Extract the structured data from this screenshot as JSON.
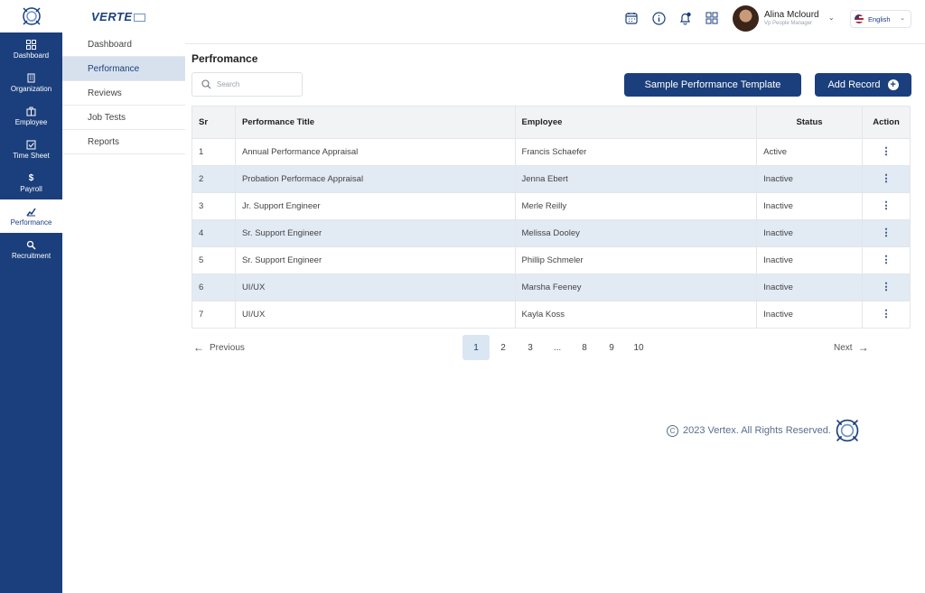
{
  "brand": {
    "name": "VERTE"
  },
  "rail": {
    "items": [
      {
        "label": "Dashboard",
        "icon": "grid-icon"
      },
      {
        "label": "Organization",
        "icon": "building-icon"
      },
      {
        "label": "Employee",
        "icon": "briefcase-icon"
      },
      {
        "label": "Time Sheet",
        "icon": "check-square-icon"
      },
      {
        "label": "Payroll",
        "icon": "dollar-icon"
      },
      {
        "label": "Performance",
        "icon": "chart-icon"
      },
      {
        "label": "Recruitment",
        "icon": "search-person-icon"
      }
    ],
    "active": "Performance"
  },
  "subnav": {
    "items": [
      {
        "label": "Dashboard"
      },
      {
        "label": "Performance"
      },
      {
        "label": "Reviews"
      },
      {
        "label": "Job Tests"
      },
      {
        "label": "Reports"
      }
    ],
    "active": "Performance"
  },
  "user": {
    "name": "Alina Mclourd",
    "role": "Vp People Manager"
  },
  "language": {
    "label": "English"
  },
  "page": {
    "title": "Perfromance"
  },
  "search": {
    "placeholder": "Search"
  },
  "buttons": {
    "template": "Sample Performance Template",
    "add": "Add Record"
  },
  "table": {
    "headers": {
      "sr": "Sr",
      "title": "Performance Title",
      "employee": "Employee",
      "status": "Status",
      "action": "Action"
    },
    "rows": [
      {
        "sr": "1",
        "title": "Annual Performance Appraisal",
        "employee": "Francis Schaefer",
        "status": "Active"
      },
      {
        "sr": "2",
        "title": "Probation Performace Appraisal",
        "employee": "Jenna Ebert",
        "status": "Inactive"
      },
      {
        "sr": "3",
        "title": "Jr. Support Engineer",
        "employee": "Merle Reilly",
        "status": "Inactive"
      },
      {
        "sr": "4",
        "title": "Sr. Support Engineer",
        "employee": "Melissa Dooley",
        "status": "Inactive"
      },
      {
        "sr": "5",
        "title": "Sr. Support Engineer",
        "employee": "Phillip Schmeler",
        "status": "Inactive"
      },
      {
        "sr": "6",
        "title": "UI/UX",
        "employee": "Marsha Feeney",
        "status": "Inactive"
      },
      {
        "sr": "7",
        "title": "UI/UX",
        "employee": "Kayla Koss",
        "status": "Inactive"
      }
    ]
  },
  "pagination": {
    "previous": "Previous",
    "next": "Next",
    "pages": [
      "1",
      "2",
      "3",
      "...",
      "8",
      "9",
      "10"
    ],
    "current": "1"
  },
  "footer": {
    "text": "2023 Vertex. All Rights Reserved."
  },
  "colors": {
    "primary": "#1b3f7c",
    "active": "#22a34a",
    "inactive": "#e5484d",
    "row_alt": "#e2eaf4"
  }
}
